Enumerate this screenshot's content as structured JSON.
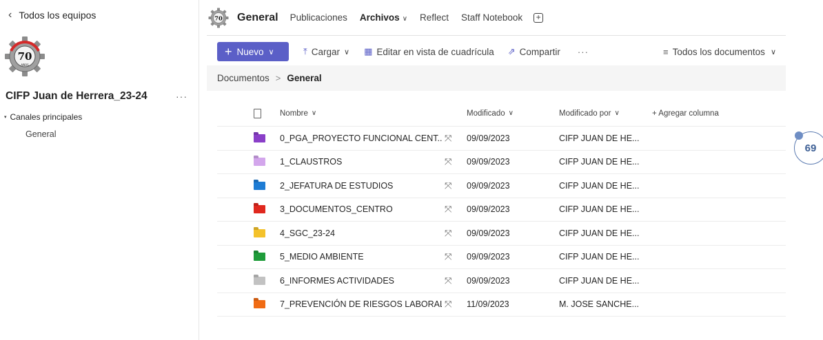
{
  "sidebar": {
    "back_label": "Todos los equipos",
    "team_name": "CIFP Juan de Herrera_23-24",
    "more_label": "···",
    "channels_heading": "Canales principales",
    "channels": [
      "General"
    ],
    "logo": {
      "number": "70",
      "text": "AÑOS"
    }
  },
  "header": {
    "channel_title": "General",
    "tabs": [
      "Publicaciones",
      "Archivos",
      "Reflect",
      "Staff Notebook"
    ],
    "active_tab": "Archivos",
    "logo_number": "70"
  },
  "toolbar": {
    "new_label": "Nuevo",
    "upload_label": "Cargar",
    "grid_label": "Editar en vista de cuadrícula",
    "share_label": "Compartir",
    "more_label": "···",
    "view_label": "Todos los documentos"
  },
  "breadcrumb": {
    "root": "Documentos",
    "current": "General"
  },
  "columns": {
    "name": "Nombre",
    "modified": "Modificado",
    "modified_by": "Modificado por",
    "add_column": "+ Agregar columna"
  },
  "files": [
    {
      "name": "0_PGA_PROYECTO FUNCIONAL CENT...",
      "modified": "09/09/2023",
      "modified_by": "CIFP JUAN DE HE...",
      "color": "#8a3fc8"
    },
    {
      "name": "1_CLAUSTROS",
      "modified": "09/09/2023",
      "modified_by": "CIFP JUAN DE HE...",
      "color": "#d3a6ec"
    },
    {
      "name": "2_JEFATURA DE ESTUDIOS",
      "modified": "09/09/2023",
      "modified_by": "CIFP JUAN DE HE...",
      "color": "#1e7cd4"
    },
    {
      "name": "3_DOCUMENTOS_CENTRO",
      "modified": "09/09/2023",
      "modified_by": "CIFP JUAN DE HE...",
      "color": "#e0281e"
    },
    {
      "name": "4_SGC_23-24",
      "modified": "09/09/2023",
      "modified_by": "CIFP JUAN DE HE...",
      "color": "#f4c22b"
    },
    {
      "name": "5_MEDIO AMBIENTE",
      "modified": "09/09/2023",
      "modified_by": "CIFP JUAN DE HE...",
      "color": "#1f9c3a"
    },
    {
      "name": "6_INFORMES ACTIVIDADES",
      "modified": "09/09/2023",
      "modified_by": "CIFP JUAN DE HE...",
      "color": "#c2c2c2"
    },
    {
      "name": "7_PREVENCIÓN DE RIESGOS LABORAL...",
      "modified": "11/09/2023",
      "modified_by": "M. JOSE SANCHE...",
      "color": "#f06b14"
    }
  ],
  "badge": {
    "value": "69"
  }
}
